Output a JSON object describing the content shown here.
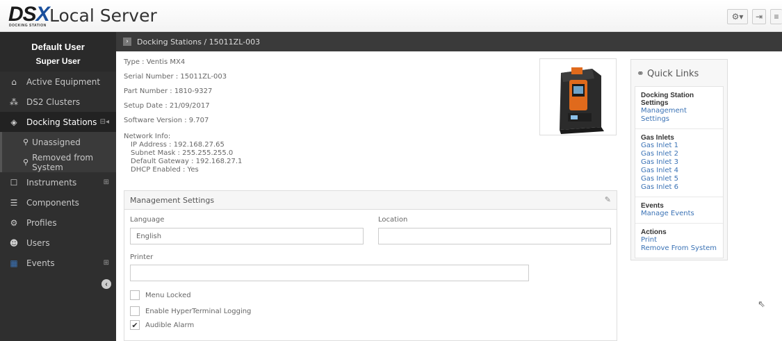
{
  "header": {
    "logo_text": "DSX",
    "logo_subtext": "DOCKING STATION",
    "title": "Local Server",
    "buttons": [
      {
        "name": "settings-button",
        "icon": "gear-icon"
      },
      {
        "name": "logout-button",
        "icon": "logout-icon"
      },
      {
        "name": "menu-button",
        "icon": "hamburger-icon"
      }
    ]
  },
  "sidebar": {
    "user_name": "Default User",
    "user_role": "Super User",
    "items": [
      {
        "label": "Active Equipment",
        "icon": "home-icon"
      },
      {
        "label": "DS2 Clusters",
        "icon": "cluster-icon"
      },
      {
        "label": "Docking Stations",
        "icon": "cube-icon",
        "active": true
      },
      {
        "label": "Instruments",
        "icon": "square-icon"
      },
      {
        "label": "Components",
        "icon": "database-icon"
      },
      {
        "label": "Profiles",
        "icon": "cogs-icon"
      },
      {
        "label": "Users",
        "icon": "users-icon"
      },
      {
        "label": "Events",
        "icon": "calendar-icon"
      }
    ],
    "sub_items": [
      {
        "label": "Unassigned"
      },
      {
        "label": "Removed from System"
      }
    ]
  },
  "breadcrumb": {
    "text": "Docking Stations / 15011ZL-003"
  },
  "info": {
    "type": "Type : Ventis MX4",
    "serial": "Serial Number : 15011ZL-003",
    "part": "Part Number : 1810-9327",
    "setup": "Setup Date : 21/09/2017",
    "software": "Software Version : 9.707",
    "network_label": "Network Info:",
    "ip": "IP Address : 192.168.27.65",
    "subnet": "Subnet Mask : 255.255.255.0",
    "gateway": "Default Gateway : 192.168.27.1",
    "dhcp": "DHCP Enabled : Yes"
  },
  "quick_links": {
    "title": "Quick Links",
    "sections": [
      {
        "heading": "Docking Station Settings",
        "links": [
          "Management Settings"
        ]
      },
      {
        "heading": "Gas Inlets",
        "links": [
          "Gas Inlet 1",
          "Gas Inlet 2",
          "Gas Inlet 3",
          "Gas Inlet 4",
          "Gas Inlet 5",
          "Gas Inlet 6"
        ]
      },
      {
        "heading": "Events",
        "links": [
          "Manage Events"
        ]
      },
      {
        "heading": "Actions",
        "links": [
          "Print",
          "Remove From System"
        ]
      }
    ]
  },
  "management": {
    "title": "Management Settings",
    "language_label": "Language",
    "language_value": "English",
    "location_label": "Location",
    "location_value": "",
    "printer_label": "Printer",
    "printer_value": "",
    "checkboxes": [
      {
        "label": "Menu Locked",
        "checked": false
      },
      {
        "label": "Enable HyperTerminal Logging",
        "checked": false
      },
      {
        "label": "Audible Alarm",
        "checked": true
      }
    ]
  },
  "colors": {
    "sidebar_bg": "#2f2f2f",
    "link": "#3a72b5",
    "logo_blue": "#1a4f9c"
  }
}
